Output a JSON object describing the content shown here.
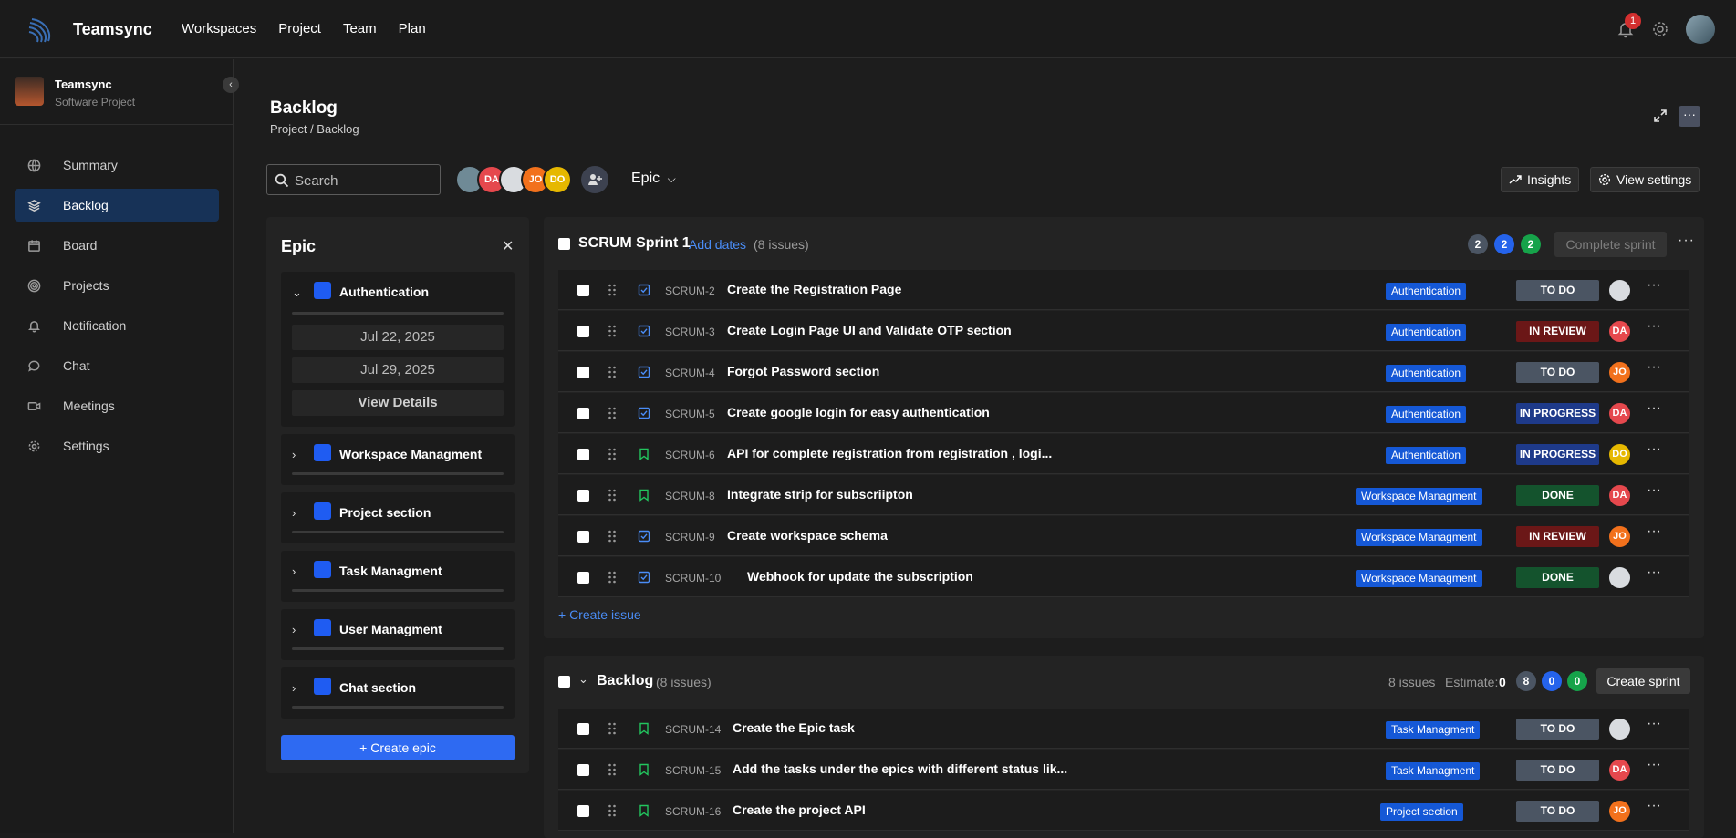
{
  "app": {
    "name": "Teamsync"
  },
  "topnav": [
    "Workspaces",
    "Project",
    "Team",
    "Plan"
  ],
  "notifications": {
    "count": "1"
  },
  "project": {
    "name": "Teamsync",
    "type": "Software Project"
  },
  "sidebar": {
    "items": [
      {
        "label": "Summary",
        "icon": "globe-icon",
        "active": false
      },
      {
        "label": "Backlog",
        "icon": "layers-icon",
        "active": true
      },
      {
        "label": "Board",
        "icon": "calendar-icon",
        "active": false
      },
      {
        "label": "Projects",
        "icon": "target-icon",
        "active": false
      },
      {
        "label": "Notification",
        "icon": "bell-icon",
        "active": false
      },
      {
        "label": "Chat",
        "icon": "chat-icon",
        "active": false
      },
      {
        "label": "Meetings",
        "icon": "video-icon",
        "active": false
      },
      {
        "label": "Settings",
        "icon": "gear-icon",
        "active": false
      }
    ]
  },
  "page": {
    "title": "Backlog",
    "breadcrumb": "Project / Backlog"
  },
  "toolbar": {
    "search_placeholder": "Search",
    "avatars": [
      {
        "initials": "",
        "color": "#6f8a96"
      },
      {
        "initials": "DA",
        "color": "#e5484d"
      },
      {
        "initials": "",
        "color": "#d9dce0"
      },
      {
        "initials": "JO",
        "color": "#f2711c"
      },
      {
        "initials": "DO",
        "color": "#e6b800"
      }
    ],
    "epic_label": "Epic",
    "insights_label": "Insights",
    "view_settings_label": "View settings"
  },
  "epic_panel": {
    "title": "Epic",
    "epics": [
      {
        "name": "Authentication",
        "expanded": true,
        "start": "Jul 22, 2025",
        "end": "Jul 29, 2025",
        "details": "View Details"
      },
      {
        "name": "Workspace Managment",
        "expanded": false
      },
      {
        "name": "Project section",
        "expanded": false
      },
      {
        "name": "Task Managment",
        "expanded": false
      },
      {
        "name": "User Managment",
        "expanded": false
      },
      {
        "name": "Chat section",
        "expanded": false
      }
    ],
    "create_label": "+ Create epic"
  },
  "sprint": {
    "title": "SCRUM Sprint 1",
    "add_dates": "Add dates",
    "issue_count": "(8 issues)",
    "counts": [
      {
        "value": "2",
        "color": "#4b5563"
      },
      {
        "value": "2",
        "color": "#2563eb"
      },
      {
        "value": "2",
        "color": "#16a34a"
      }
    ],
    "complete_label": "Complete sprint",
    "create_issue": "+ Create issue",
    "issues": [
      {
        "type": "task",
        "key": "SCRUM-2",
        "summary": "Create the Registration Page",
        "epic": "Authentication",
        "status": "TO DO",
        "assignee": ""
      },
      {
        "type": "task",
        "key": "SCRUM-3",
        "summary": "Create Login Page UI and Validate OTP section",
        "epic": "Authentication",
        "status": "IN REVIEW",
        "assignee": "DA"
      },
      {
        "type": "task",
        "key": "SCRUM-4",
        "summary": "Forgot Password section",
        "epic": "Authentication",
        "status": "TO DO",
        "assignee": "JO"
      },
      {
        "type": "task",
        "key": "SCRUM-5",
        "summary": "Create google login for easy authentication",
        "epic": "Authentication",
        "status": "IN PROGRESS",
        "assignee": "DA"
      },
      {
        "type": "story",
        "key": "SCRUM-6",
        "summary": "API for complete registration from registration , logi...",
        "epic": "Authentication",
        "status": "IN PROGRESS",
        "assignee": "DO"
      },
      {
        "type": "story",
        "key": "SCRUM-8",
        "summary": "Integrate strip for subscriipton",
        "epic": "Workspace Managment",
        "status": "DONE",
        "assignee": "DA"
      },
      {
        "type": "task",
        "key": "SCRUM-9",
        "summary": "Create workspace schema",
        "epic": "Workspace Managment",
        "status": "IN REVIEW",
        "assignee": "JO"
      },
      {
        "type": "task",
        "key": "SCRUM-10",
        "summary": "Webhook for update the subscription",
        "epic": "Workspace Managment",
        "status": "DONE",
        "assignee": ""
      }
    ]
  },
  "backlog": {
    "title": "Backlog",
    "issue_count": "(8 issues)",
    "issues_text": "8 issues",
    "estimate_label": "Estimate:",
    "estimate_value": "0",
    "counts": [
      {
        "value": "8",
        "color": "#4b5563"
      },
      {
        "value": "0",
        "color": "#2563eb"
      },
      {
        "value": "0",
        "color": "#16a34a"
      }
    ],
    "create_sprint_label": "Create sprint",
    "issues": [
      {
        "type": "story",
        "key": "SCRUM-14",
        "summary": "Create the Epic task",
        "epic": "Task Managment",
        "status": "TO DO",
        "assignee": ""
      },
      {
        "type": "story",
        "key": "SCRUM-15",
        "summary": "Add the tasks under the epics with different status lik...",
        "epic": "Task Managment",
        "status": "TO DO",
        "assignee": "DA"
      },
      {
        "type": "story",
        "key": "SCRUM-16",
        "summary": "Create the project API",
        "epic": "Project section",
        "status": "TO DO",
        "assignee": "JO"
      }
    ]
  },
  "status_colors": {
    "TO DO": "#4b5563",
    "IN REVIEW": "#6b1717",
    "IN PROGRESS": "#1e3a8a",
    "DONE": "#14532d"
  },
  "assignee_colors": {
    "DA": "#e5484d",
    "JO": "#f2711c",
    "DO": "#e6b800",
    "": "#d9dce0"
  }
}
